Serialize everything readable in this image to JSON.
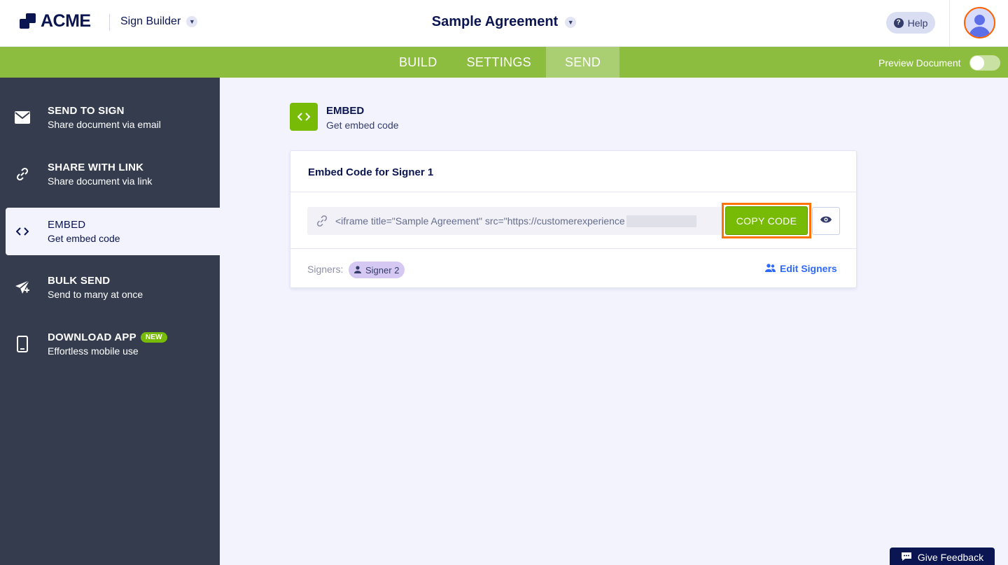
{
  "header": {
    "brand": "ACME",
    "app_switcher": "Sign Builder",
    "document_title": "Sample Agreement",
    "help_label": "Help"
  },
  "nav": {
    "tabs": [
      "BUILD",
      "SETTINGS",
      "SEND"
    ],
    "active_tab": "SEND",
    "preview_label": "Preview Document",
    "preview_enabled": false
  },
  "sidebar": {
    "items": [
      {
        "title": "SEND TO SIGN",
        "subtitle": "Share document via email",
        "icon": "envelope-icon"
      },
      {
        "title": "SHARE WITH LINK",
        "subtitle": "Share document via link",
        "icon": "link-icon"
      },
      {
        "title": "EMBED",
        "subtitle": "Get embed code",
        "icon": "code-icon",
        "active": true
      },
      {
        "title": "BULK SEND",
        "subtitle": "Send to many at once",
        "icon": "paper-plane-icon"
      },
      {
        "title": "DOWNLOAD APP",
        "subtitle": "Effortless mobile use",
        "icon": "mobile-phone-icon",
        "badge": "NEW"
      }
    ]
  },
  "main": {
    "section_title": "EMBED",
    "section_subtitle": "Get embed code",
    "card": {
      "title": "Embed Code for Signer 1",
      "code": "<iframe title=\"Sample Agreement\" src=\"https://customerexperience",
      "copy_label": "COPY CODE",
      "signers_label": "Signers:",
      "signer_chip": "Signer 2",
      "edit_label": "Edit Signers"
    }
  },
  "feedback_label": "Give Feedback",
  "colors": {
    "brand_navy": "#0a1551",
    "nav_green": "#8cbd3e",
    "button_green": "#78bb07",
    "highlight_orange": "#ff7400",
    "sidebar_bg": "#343c4e",
    "link_blue": "#2e69ff"
  }
}
